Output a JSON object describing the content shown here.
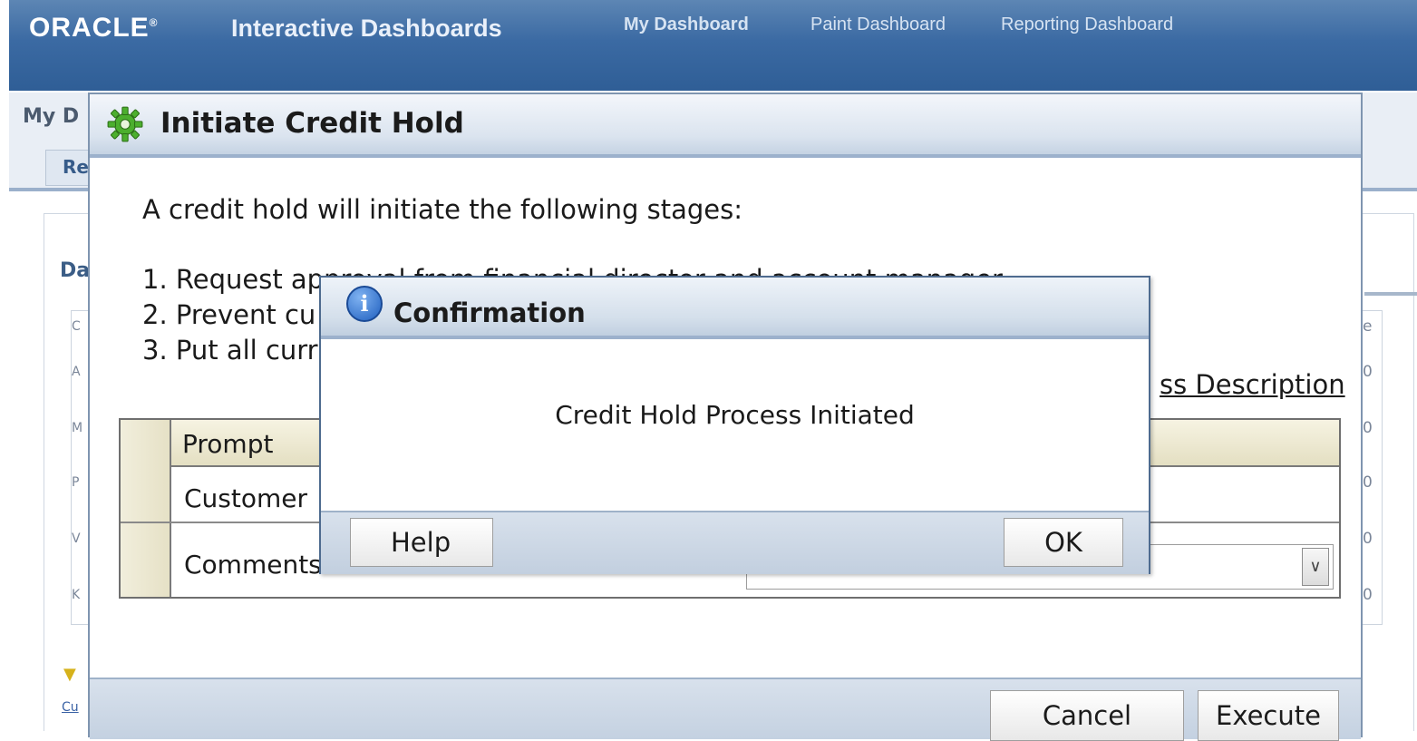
{
  "header": {
    "logo": "ORACLE",
    "app_title": "Interactive Dashboards",
    "nav": [
      "My Dashboard",
      "Paint Dashboard",
      "Reporting Dashboard"
    ]
  },
  "background": {
    "page_title_partial": "My D",
    "tab_partial": "Re",
    "section_partial": "Da",
    "table_header_partial": "C",
    "rows_partial": [
      "A",
      "M",
      "P",
      "V",
      "K"
    ],
    "right_header_partial": "e",
    "right_values": [
      "0",
      "0",
      "0",
      "0",
      "0"
    ],
    "link_partial": "Cu"
  },
  "credit_hold_dialog": {
    "title": "Initiate Credit Hold",
    "intro": "A credit hold will initiate the following stages:",
    "stages": [
      "1. Request approval from financial director and account manager",
      "2. Prevent cu",
      "3. Put all curr"
    ],
    "process_link": "ss Description",
    "table": {
      "header": "Prompt",
      "rows": [
        "Customer",
        "Comments"
      ]
    },
    "buttons": {
      "cancel": "Cancel",
      "execute": "Execute"
    }
  },
  "confirmation_dialog": {
    "title": "Confirmation",
    "message": "Credit Hold Process Initiated",
    "buttons": {
      "help": "Help",
      "ok": "OK"
    }
  },
  "colors": {
    "header_blue": "#3b6aa3",
    "dialog_border": "#7f95b0",
    "info_icon": "#1f5fbf"
  },
  "icons": [
    "gear-icon",
    "info-icon",
    "chevron-down-icon",
    "filter-icon"
  ]
}
